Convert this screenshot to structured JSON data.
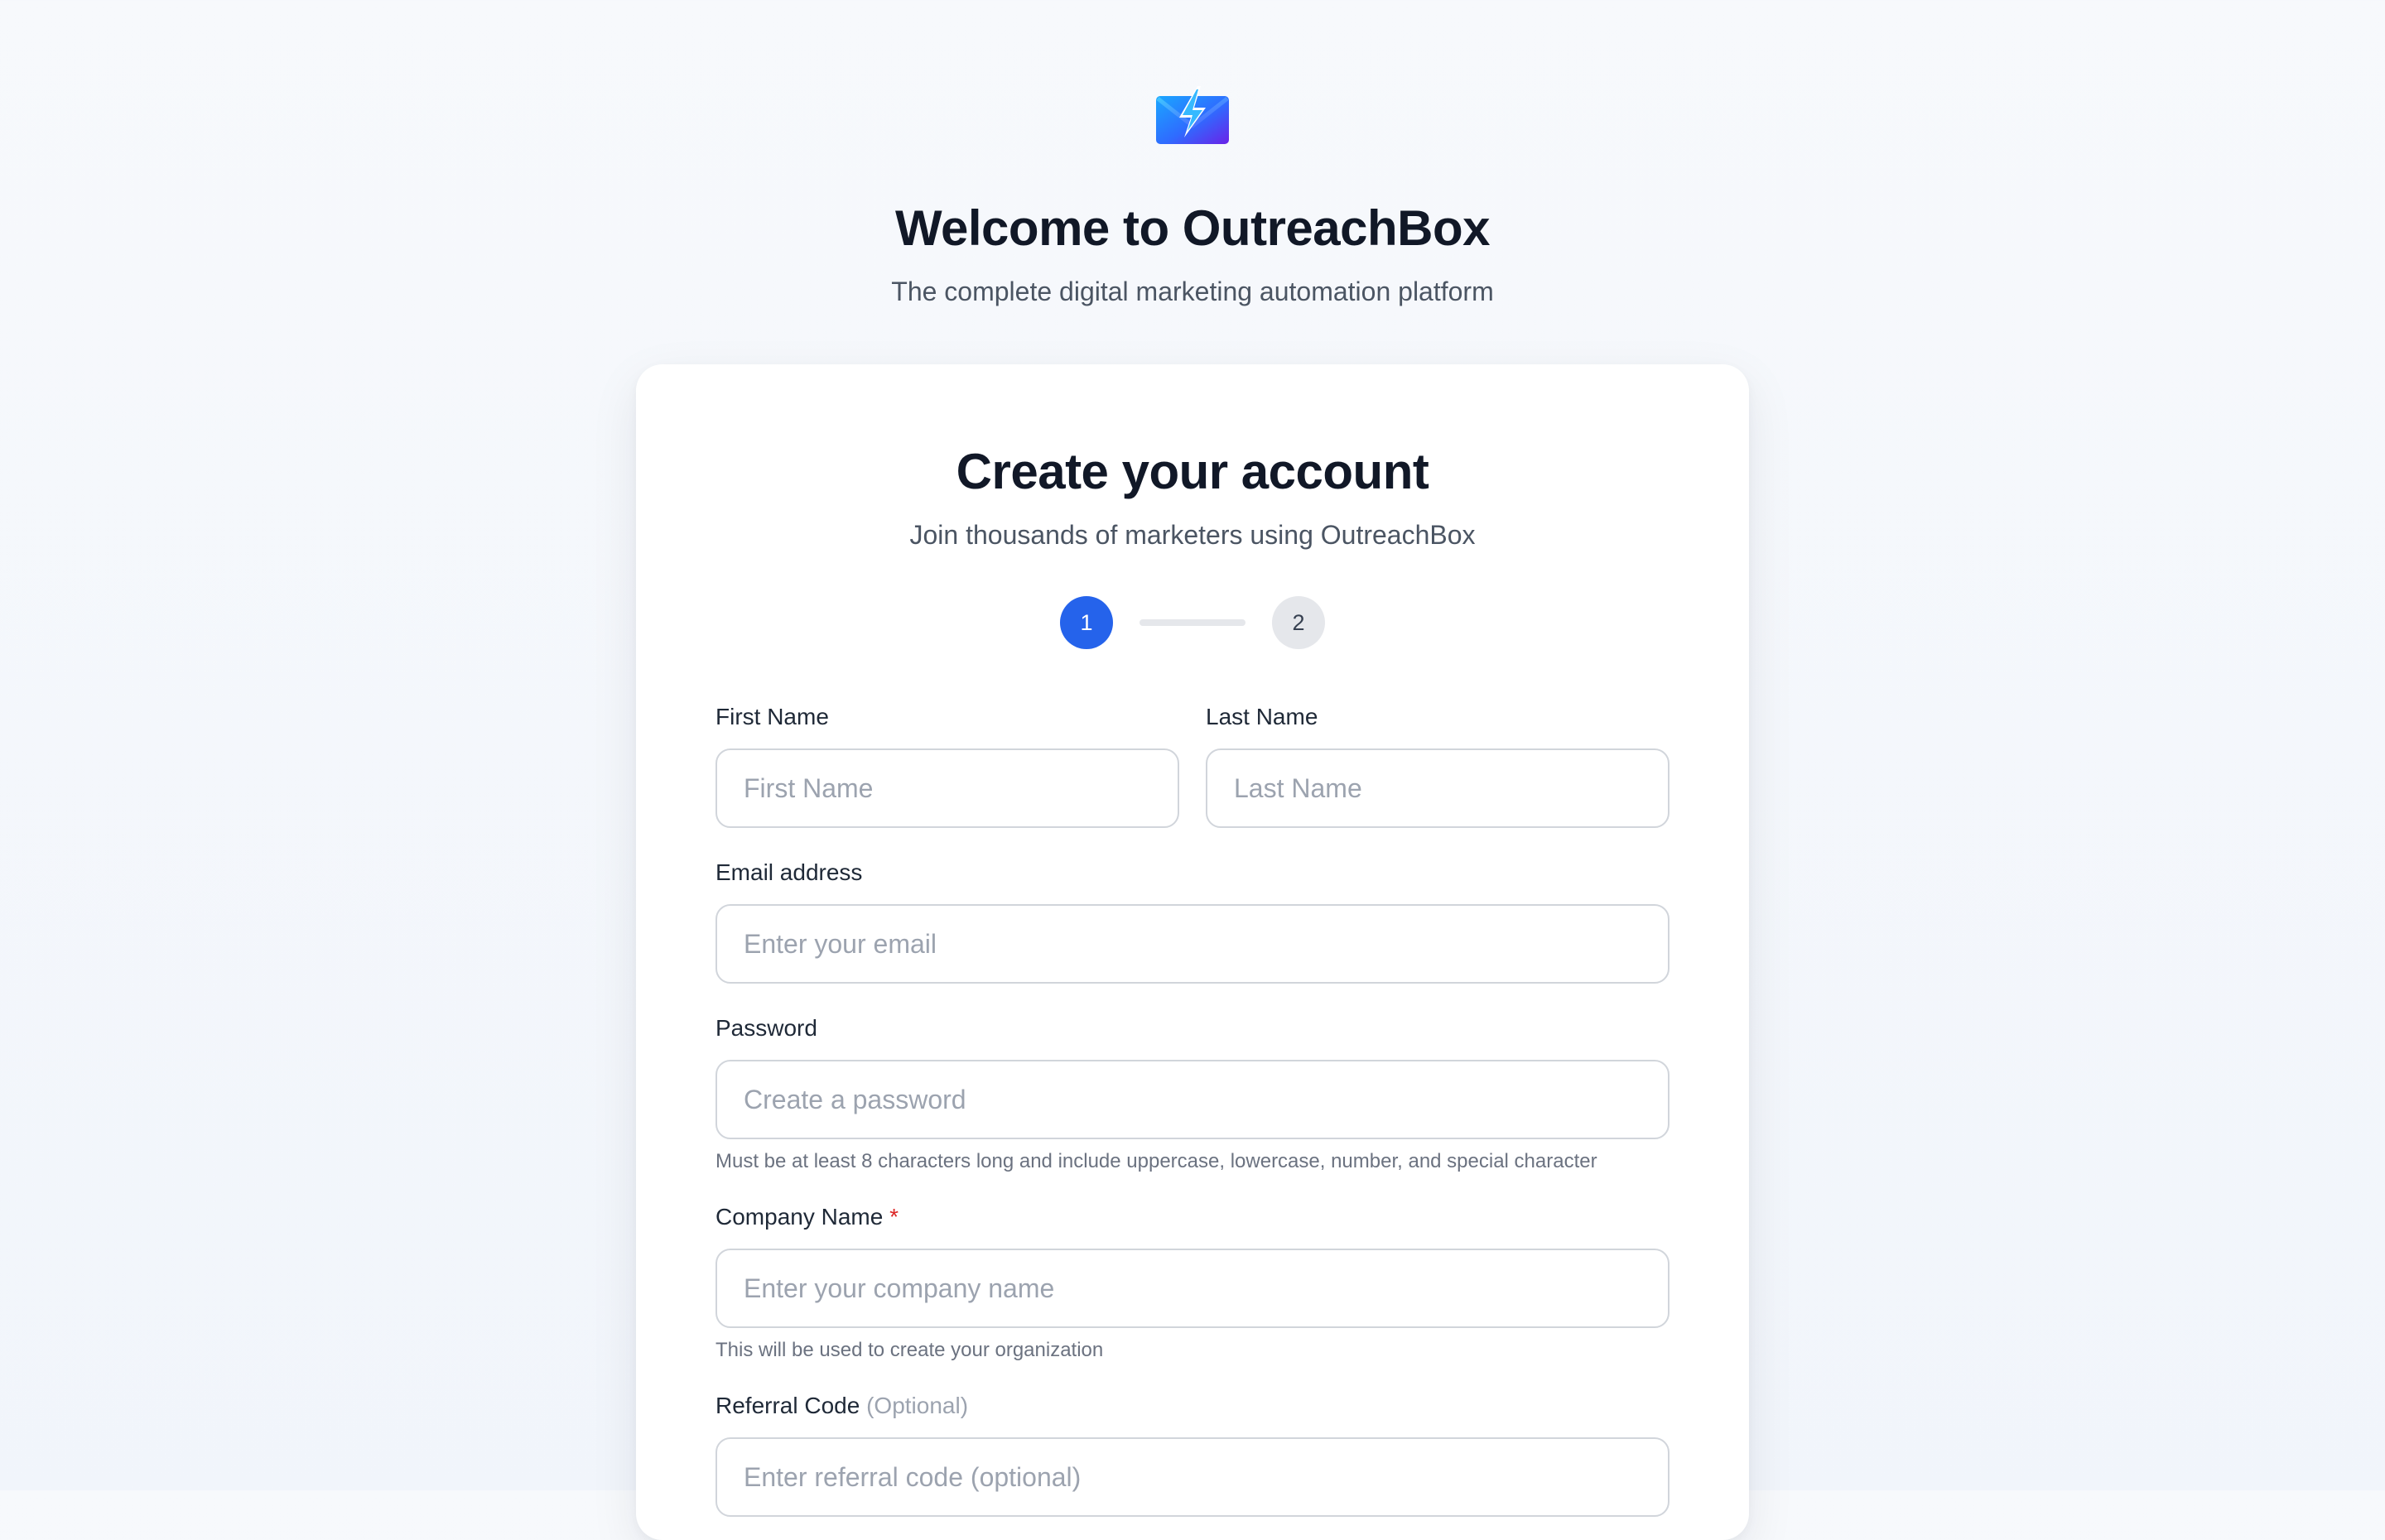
{
  "brand": {
    "logo_icon": "lightning-envelope-icon",
    "title": "Welcome to OutreachBox",
    "subtitle": "The complete digital marketing automation platform"
  },
  "card": {
    "title": "Create your account",
    "subtitle": "Join thousands of marketers using OutreachBox",
    "steps": [
      {
        "label": "1",
        "state": "active"
      },
      {
        "label": "2",
        "state": "inactive"
      }
    ]
  },
  "form": {
    "first_name": {
      "label": "First Name",
      "placeholder": "First Name",
      "value": ""
    },
    "last_name": {
      "label": "Last Name",
      "placeholder": "Last Name",
      "value": ""
    },
    "email": {
      "label": "Email address",
      "placeholder": "Enter your email",
      "value": ""
    },
    "password": {
      "label": "Password",
      "placeholder": "Create a password",
      "value": "",
      "hint": "Must be at least 8 characters long and include uppercase, lowercase, number, and special character"
    },
    "company": {
      "label": "Company Name",
      "required_marker": "*",
      "placeholder": "Enter your company name",
      "value": "",
      "hint": "This will be used to create your organization"
    },
    "referral": {
      "label": "Referral Code",
      "optional_tag": "(Optional)",
      "placeholder": "Enter referral code (optional)",
      "value": ""
    }
  },
  "colors": {
    "primary": "#2563eb",
    "heading": "#111827",
    "muted": "#4b5563",
    "required": "#dc2626",
    "step_inactive_bg": "#e5e7eb"
  }
}
